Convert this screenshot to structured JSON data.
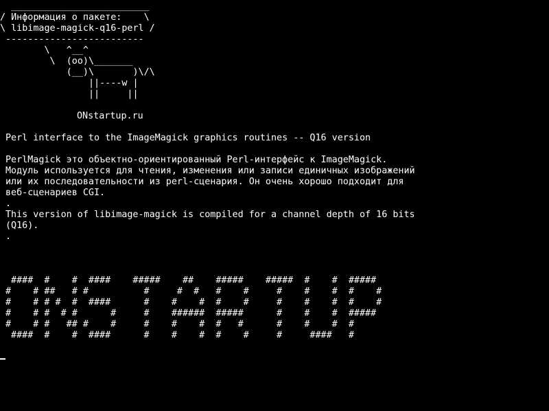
{
  "terminal": {
    "cowsay_art": [
      " _________________________",
      "/ Информация о пакете:    \\",
      "\\ libimage-magick-q16-perl /",
      " -------------------------",
      "        \\   ^__^",
      "         \\  (oo)\\_______",
      "            (__)\\       )\\/\\",
      "                ||----w |",
      "                ||     ||"
    ],
    "site": "ONstartup.ru",
    "summary": "Perl interface to the ImageMagick graphics routines -- Q16 version",
    "description": [
      "PerlMagick это объектно-ориентированный Perl-интерфейс к ImageMagick.",
      "Модуль используется для чтения, изменения или записи единичных изображений",
      "или их последовательности из perl-сценария. Он очень хорошо подходит для",
      "веб-сценариев CGI.",
      ".",
      "This version of libimage-magick is compiled for a channel depth of 16 bits",
      "(Q16).",
      "."
    ],
    "banner": [
      " ####  #    #  ####    #####    ##    #####    #####  #    #  #####",
      "#    # ##   # #          #     #  #   #    #     #    #    #  #    #",
      "#    # # #  #  ####      #    #    #  #    #     #    #    #  #    #",
      "#    # #  # #      #     #    ######  #####      #    #    #  #####",
      "#    # #   ## #    #     #    #    #  #   #      #    #    #  #",
      " ####  #    #  ####      #    #    #  #    #     #     ####   #"
    ]
  }
}
